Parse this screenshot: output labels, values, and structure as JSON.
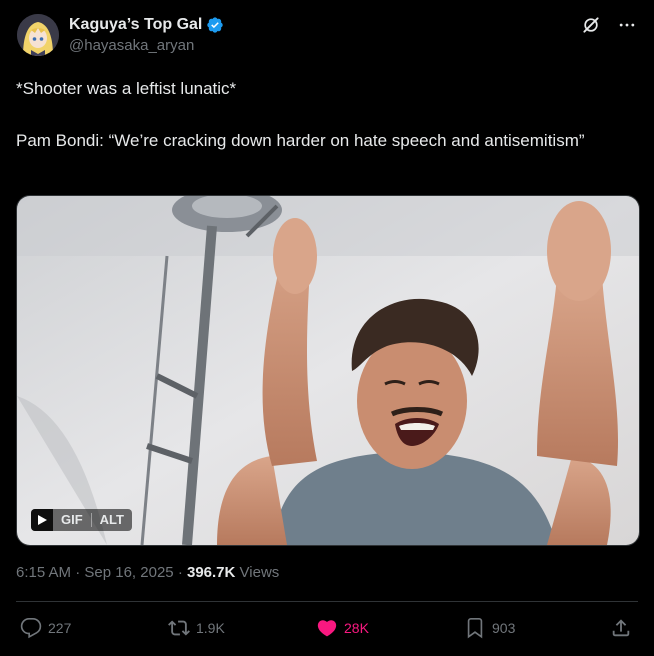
{
  "user": {
    "display_name": "Kaguya’s Top Gal",
    "handle": "@hayasaka_aryan",
    "verified": true
  },
  "post": {
    "line1": "*Shooter was a leftist lunatic*",
    "line2": "Pam Bondi: “We’re cracking down harder on hate speech and antisemitism”"
  },
  "media": {
    "gif_label": "GIF",
    "alt_label": "ALT"
  },
  "meta": {
    "time": "6:15 AM",
    "separator": "·",
    "date": "Sep 16, 2025",
    "views_count": "396.7K",
    "views_label": "Views"
  },
  "actions": {
    "replies": "227",
    "reposts": "1.9K",
    "likes": "28K",
    "bookmarks": "903"
  },
  "colors": {
    "like_active": "#f91880",
    "verified_badge": "#1d9bf0",
    "muted_text": "#71767b"
  }
}
